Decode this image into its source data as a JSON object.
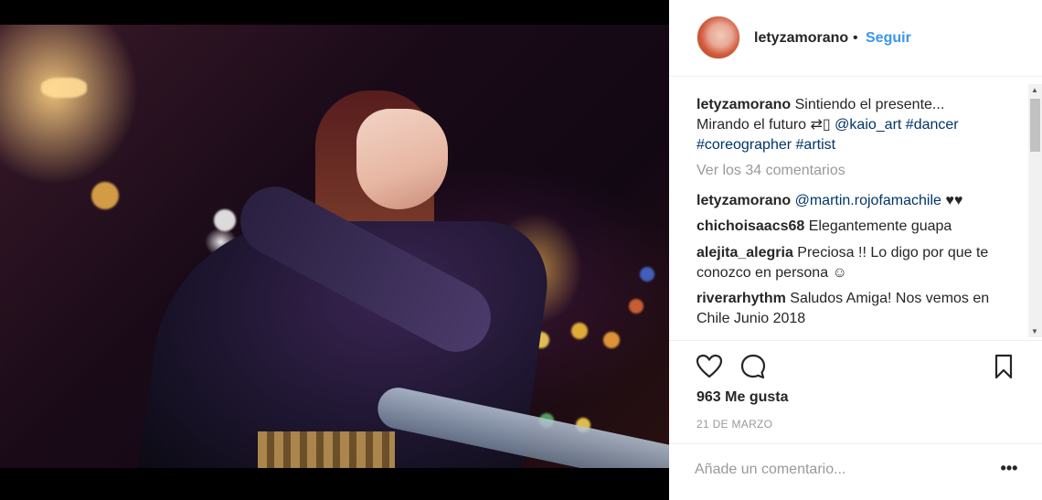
{
  "post": {
    "username": "letyzamorano",
    "separator": "•",
    "follow_label": "Seguir",
    "caption": {
      "username": "letyzamorano",
      "line1": "Sintiendo el presente...",
      "line2_text": "Mirando el futuro ⇄▯ ",
      "mention": "@kaio_art",
      "hashtag1": "#dancer",
      "hashtag2": "#coreographer",
      "hashtag3": "#artist"
    },
    "view_all_comments": "Ver los 34 comentarios",
    "comments": [
      {
        "user": "letyzamorano",
        "mention": "@martin.rojofamachile",
        "text": " ♥♥"
      },
      {
        "user": "chichoisaacs68",
        "text": "Elegantemente guapa"
      },
      {
        "user": "alejita_alegria",
        "text": "Preciosa !! Lo digo por que te",
        "text2": "conozco en persona ☺"
      },
      {
        "user": "riverarhythm",
        "text": "Saludos Amiga! Nos vemos en",
        "text2": "Chile Junio 2018"
      }
    ],
    "likes": "963 Me gusta",
    "date": "21 DE MARZO",
    "comment_placeholder": "Añade un comentario...",
    "more_label": "•••"
  },
  "icons": {
    "like": "heart-outline-icon",
    "comment": "speech-bubble-icon",
    "save": "bookmark-icon"
  }
}
